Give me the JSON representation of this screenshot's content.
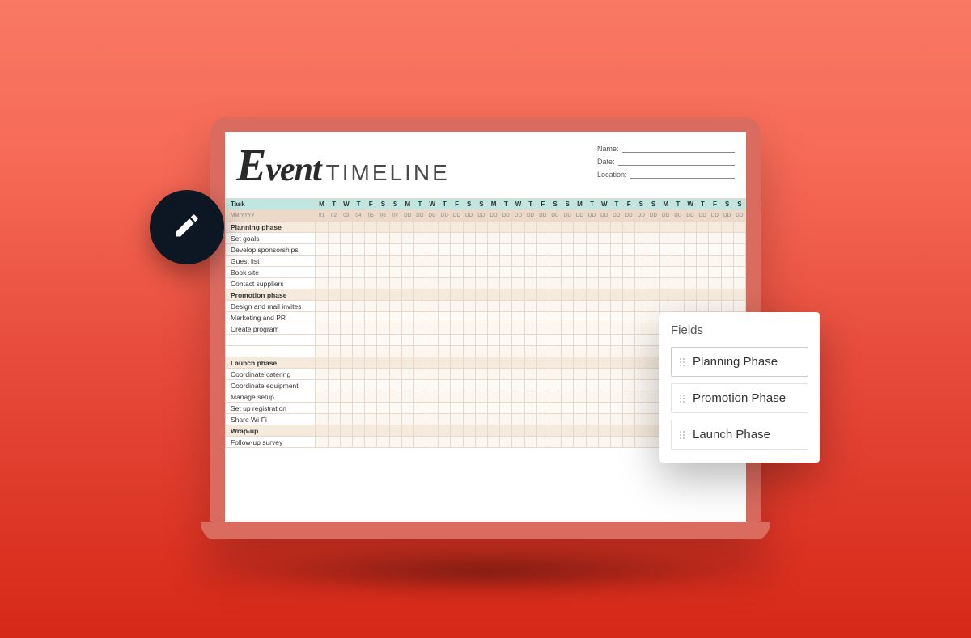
{
  "document": {
    "title_word1": "Event",
    "title_word2": "TIMELINE",
    "meta": {
      "name_label": "Name:",
      "date_label": "Date:",
      "location_label": "Location:"
    },
    "task_header": "Task",
    "day_letters": [
      "M",
      "T",
      "W",
      "T",
      "F",
      "S",
      "S"
    ],
    "weeks": 5,
    "week1_dates": [
      "01",
      "02",
      "03",
      "04",
      "05",
      "06",
      "07"
    ],
    "dd": "DD",
    "mmyyyy": "MM/YYYY",
    "rows": [
      {
        "type": "phase",
        "label": "Planning phase"
      },
      {
        "type": "task",
        "label": "Set goals"
      },
      {
        "type": "task",
        "label": "Develop sponsorships"
      },
      {
        "type": "task",
        "label": "Guest list"
      },
      {
        "type": "task",
        "label": "Book site"
      },
      {
        "type": "task",
        "label": "Contact suppliers"
      },
      {
        "type": "phase",
        "label": "Promotion phase"
      },
      {
        "type": "task",
        "label": "Design and mail invites"
      },
      {
        "type": "task",
        "label": "Marketing and PR"
      },
      {
        "type": "task",
        "label": "Create program"
      },
      {
        "type": "task",
        "label": ""
      },
      {
        "type": "task",
        "label": ""
      },
      {
        "type": "phase",
        "label": "Launch phase"
      },
      {
        "type": "task",
        "label": "Coordinate catering"
      },
      {
        "type": "task",
        "label": "Coordinate equipment"
      },
      {
        "type": "task",
        "label": "Manage setup"
      },
      {
        "type": "task",
        "label": "Set up registration"
      },
      {
        "type": "task",
        "label": "Share Wi-Fi"
      },
      {
        "type": "phase",
        "label": "Wrap-up"
      },
      {
        "type": "task",
        "label": "Follow-up survey"
      }
    ]
  },
  "fields_panel": {
    "title": "Fields",
    "items": [
      "Planning Phase",
      "Promotion Phase",
      "Launch Phase"
    ]
  },
  "icons": {
    "edit": "pencil-icon"
  }
}
